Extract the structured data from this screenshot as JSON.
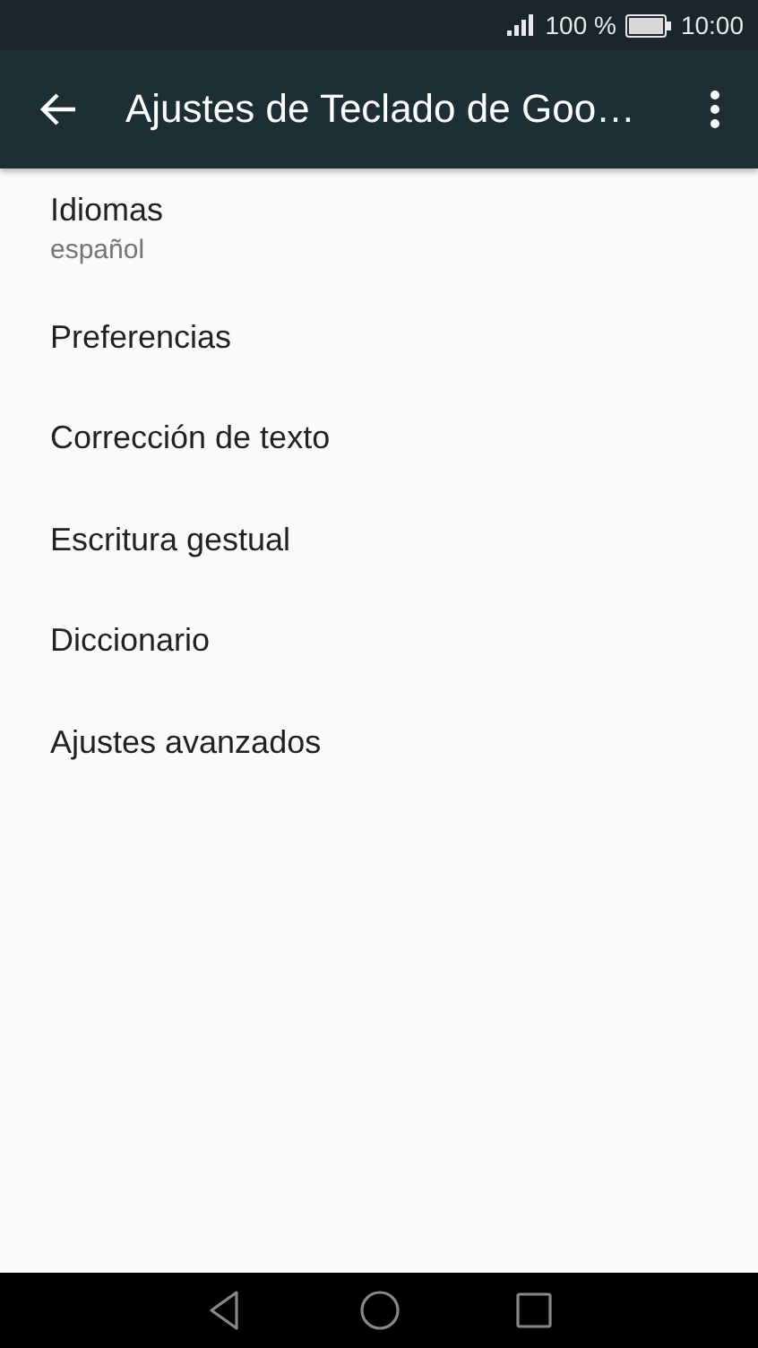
{
  "status_bar": {
    "battery_text": "100 %",
    "time": "10:00"
  },
  "app_bar": {
    "title": "Ajustes de Teclado de Goo…"
  },
  "settings": [
    {
      "title": "Idiomas",
      "summary": "español"
    },
    {
      "title": "Preferencias"
    },
    {
      "title": "Corrección de texto"
    },
    {
      "title": "Escritura gestual"
    },
    {
      "title": "Diccionario"
    },
    {
      "title": "Ajustes avanzados"
    }
  ]
}
